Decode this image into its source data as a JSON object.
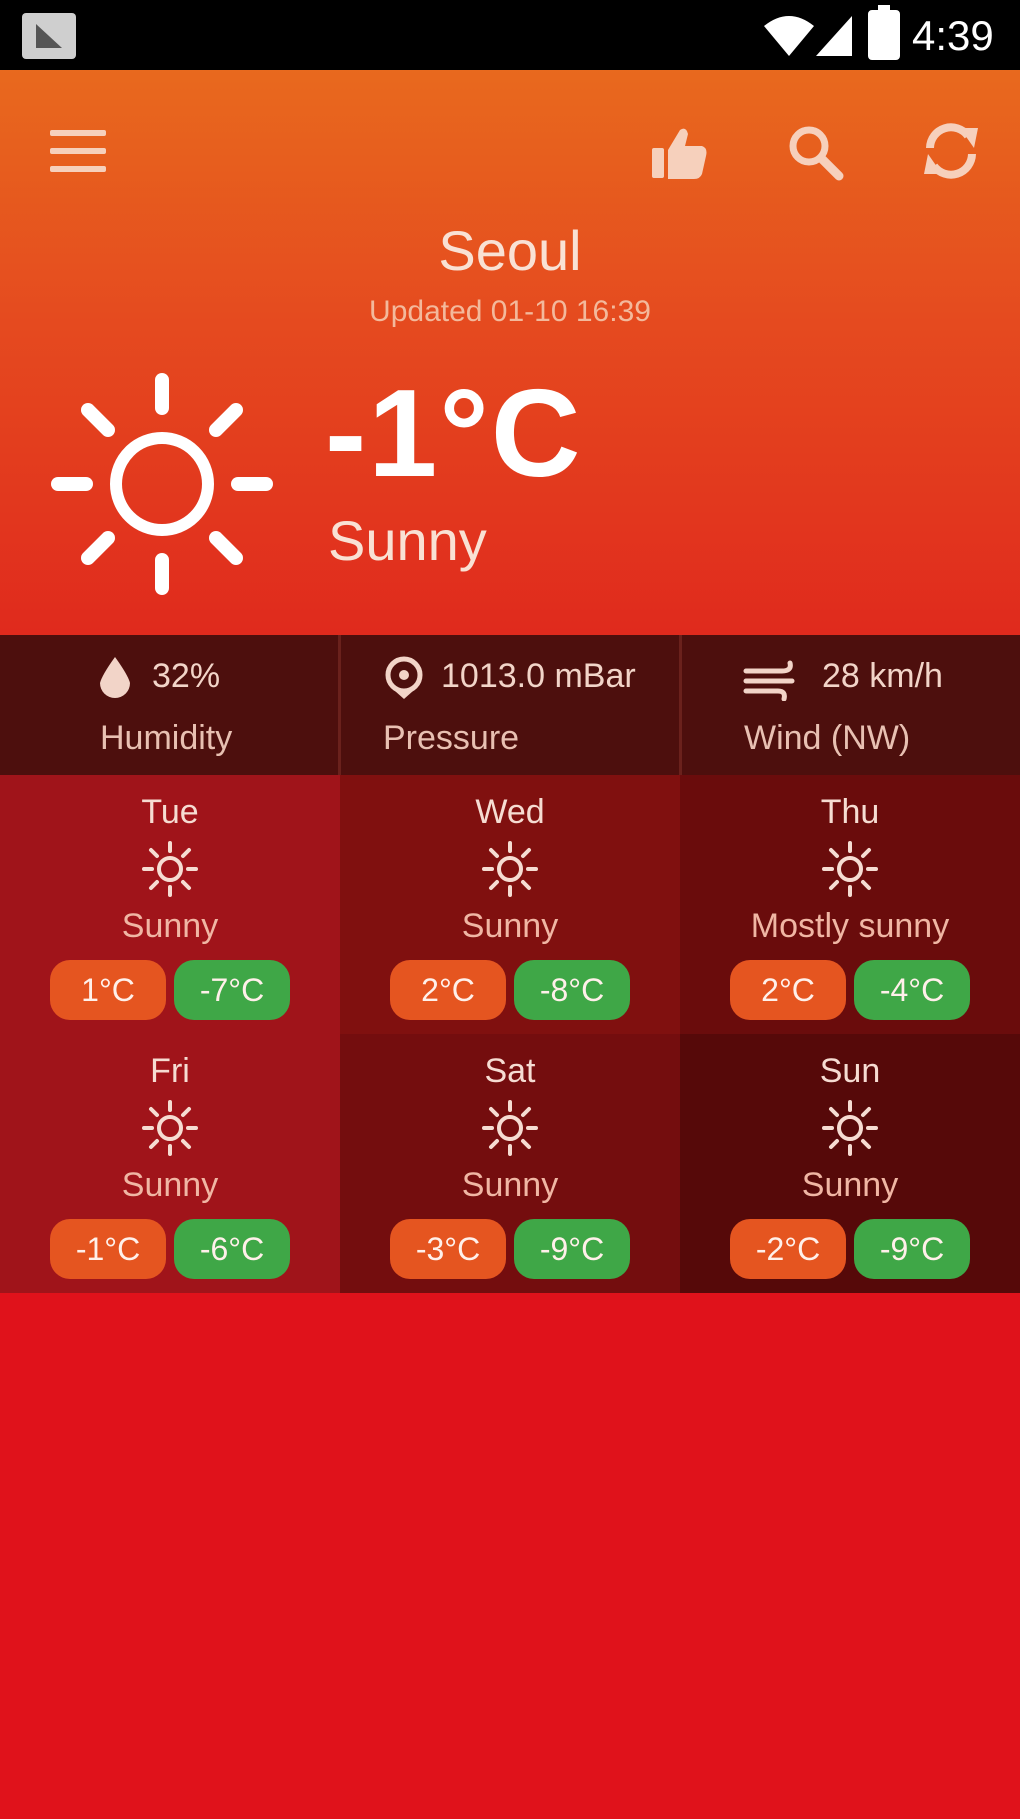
{
  "status_bar": {
    "time": "4:39"
  },
  "header": {
    "city": "Seoul",
    "updated": "Updated 01-10 16:39",
    "temperature": "-1°C",
    "condition": "Sunny"
  },
  "stats": [
    {
      "icon": "humidity-drop-icon",
      "value": "32%",
      "label": "Humidity"
    },
    {
      "icon": "pressure-gauge-icon",
      "value": "1013.0 mBar",
      "label": "Pressure"
    },
    {
      "icon": "wind-icon",
      "value": "28 km/h",
      "label": "Wind (NW)"
    }
  ],
  "forecast": [
    {
      "day": "Tue",
      "icon": "sun-icon",
      "condition": "Sunny",
      "high": "1°C",
      "low": "-7°C"
    },
    {
      "day": "Wed",
      "icon": "sun-icon",
      "condition": "Sunny",
      "high": "2°C",
      "low": "-8°C"
    },
    {
      "day": "Thu",
      "icon": "sun-icon",
      "condition": "Mostly sunny",
      "high": "2°C",
      "low": "-4°C"
    },
    {
      "day": "Fri",
      "icon": "sun-icon",
      "condition": "Sunny",
      "high": "-1°C",
      "low": "-6°C"
    },
    {
      "day": "Sat",
      "icon": "sun-icon",
      "condition": "Sunny",
      "high": "-3°C",
      "low": "-9°C"
    },
    {
      "day": "Sun",
      "icon": "sun-icon",
      "condition": "Sunny",
      "high": "-2°C",
      "low": "-9°C"
    }
  ],
  "colors": {
    "high_chip": "#e55520",
    "low_chip": "#3fa747",
    "background": "#e0121b",
    "forecast_cells": [
      "#a0141a",
      "#80100f",
      "#6a0c0c",
      "#a0141a",
      "#740d0e",
      "#560909"
    ]
  }
}
